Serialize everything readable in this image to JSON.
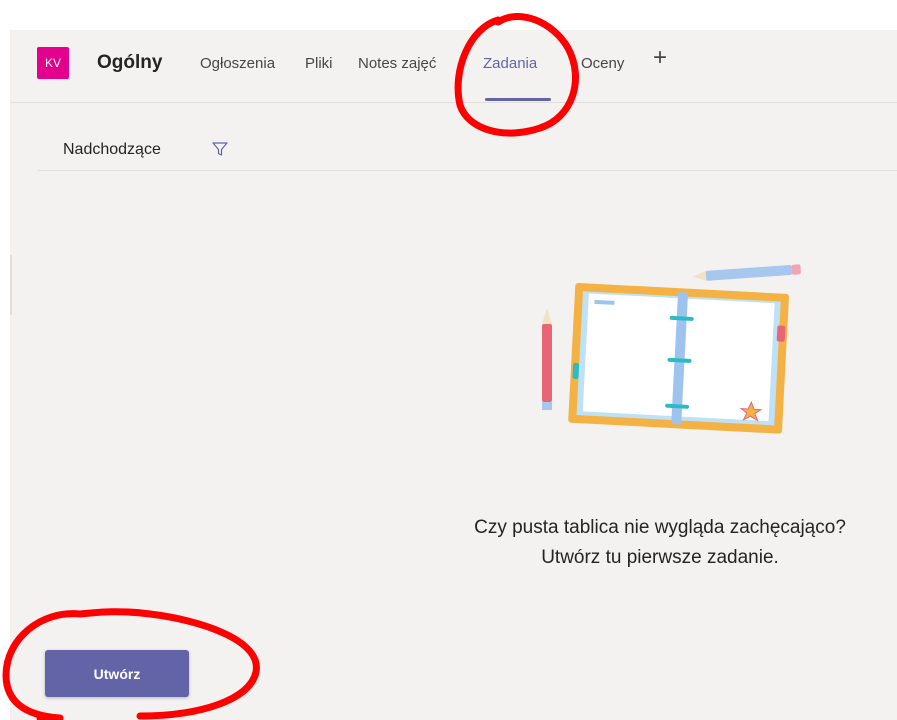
{
  "header": {
    "avatar_initials": "KV",
    "channel_title": "Ogólny",
    "tabs": [
      {
        "label": "Ogłoszenia",
        "active": false
      },
      {
        "label": "Pliki",
        "active": false
      },
      {
        "label": "Notes zajęć",
        "active": false
      },
      {
        "label": "Zadania",
        "active": true
      },
      {
        "label": "Oceny",
        "active": false
      }
    ],
    "add_tab_icon": "plus-icon"
  },
  "filter": {
    "label": "Nadchodzące",
    "icon": "filter-icon"
  },
  "empty_state": {
    "illustration": "notebook-illustration",
    "message": "Czy pusta tablica nie wygląda zachęcająco? Utwórz tu pierwsze zadanie."
  },
  "actions": {
    "create_label": "Utwórz"
  },
  "colors": {
    "accent": "#6264a7",
    "avatar": "#e3008c",
    "annotation": "#ff0000"
  }
}
